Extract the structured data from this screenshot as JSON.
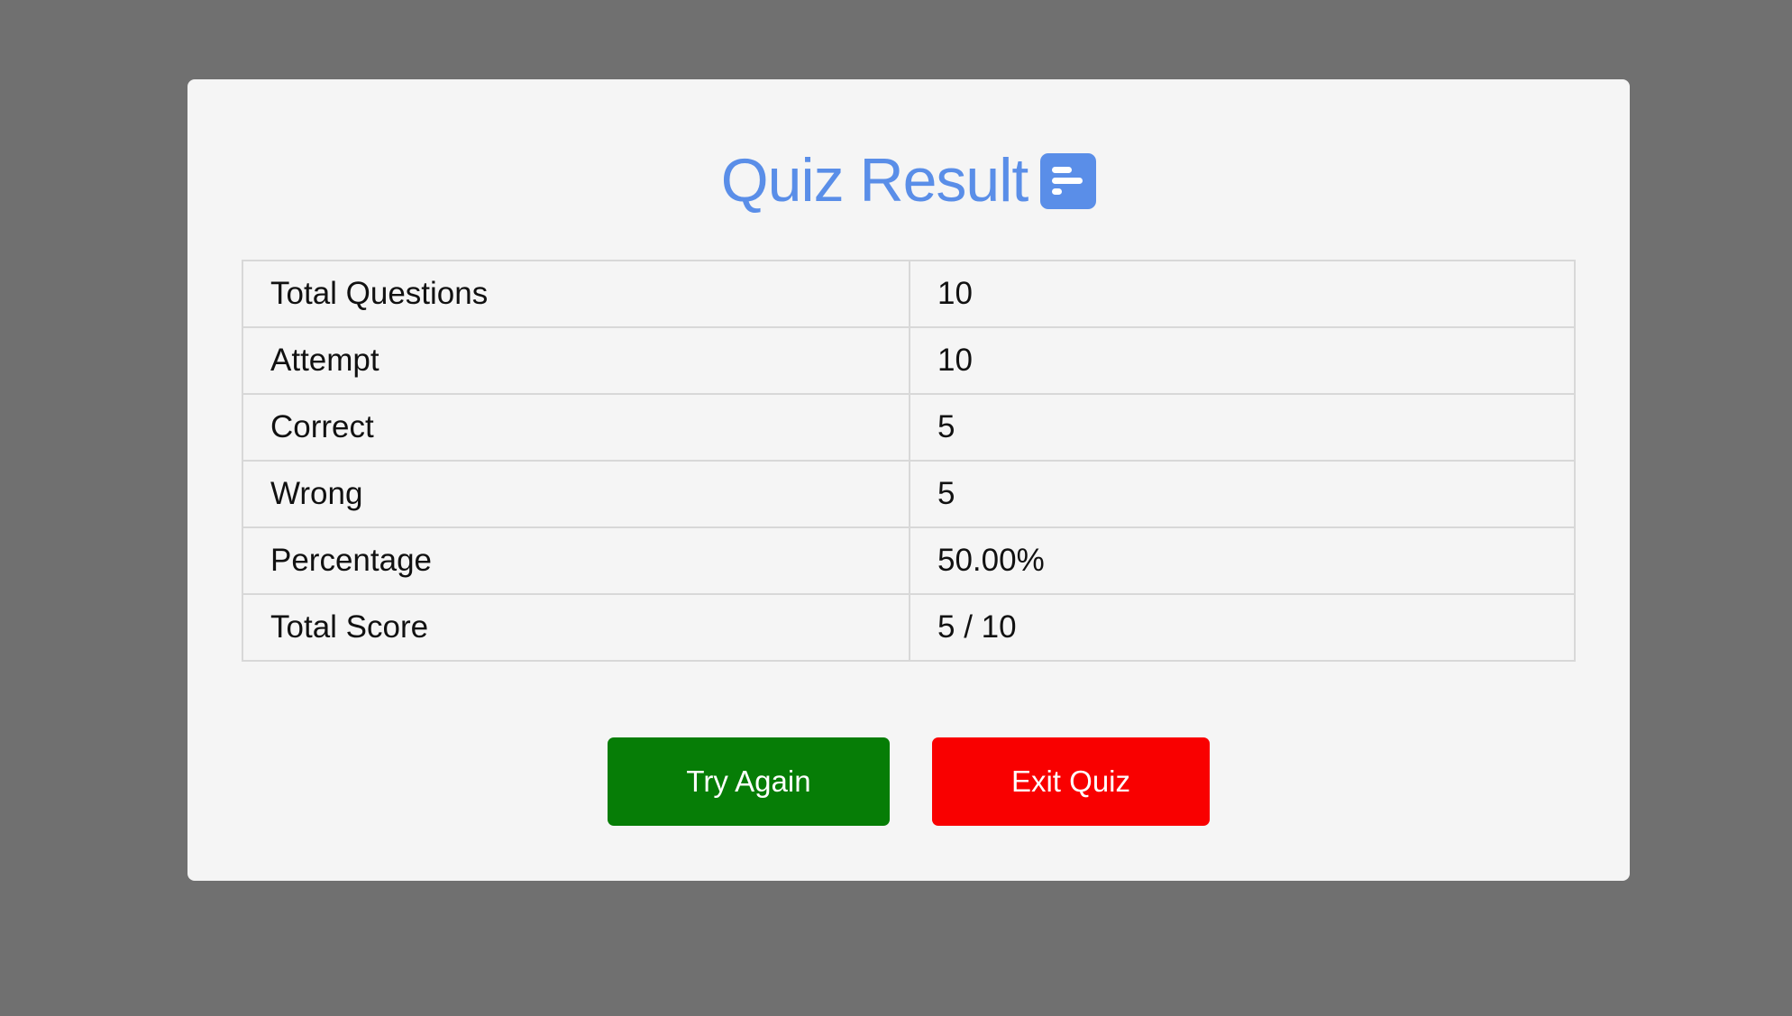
{
  "title": "Quiz Result",
  "title_icon": "stats-bars-icon",
  "results": {
    "rows": [
      {
        "label": "Total Questions",
        "value": "10"
      },
      {
        "label": "Attempt",
        "value": "10"
      },
      {
        "label": "Correct",
        "value": "5"
      },
      {
        "label": "Wrong",
        "value": "5"
      },
      {
        "label": "Percentage",
        "value": "50.00%"
      },
      {
        "label": "Total Score",
        "value": "5 / 10"
      }
    ]
  },
  "buttons": {
    "try_again": "Try Again",
    "exit_quiz": "Exit Quiz"
  },
  "colors": {
    "background": "#707070",
    "card": "#f5f5f5",
    "accent": "#5a8ee8",
    "try_again": "#067d06",
    "exit_quiz": "#f90000"
  }
}
